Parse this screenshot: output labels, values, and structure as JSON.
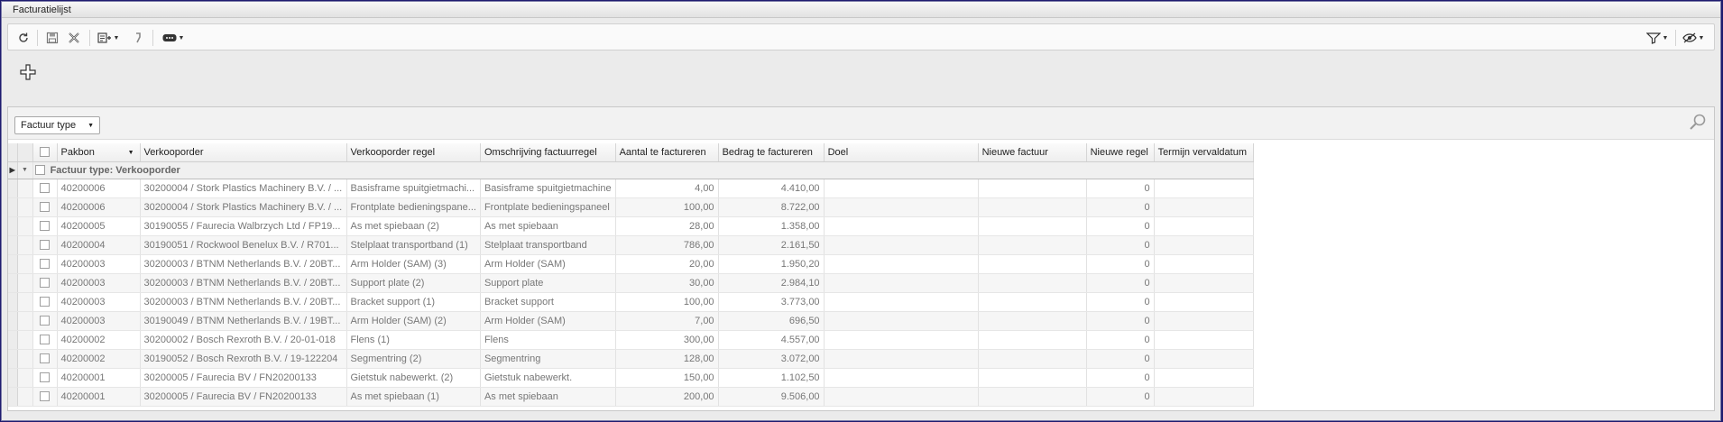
{
  "window": {
    "title": "Facturatielijst"
  },
  "toolbar": {
    "icons": [
      "refresh-icon",
      "save-icon",
      "cancel-icon",
      "export-menu-icon",
      "step-icon",
      "more-menu-icon",
      "filter-icon",
      "view-options-icon"
    ]
  },
  "group": {
    "chip_label": "Factuur type"
  },
  "grid": {
    "columns": [
      "Pakbon",
      "Verkooporder",
      "Verkooporder regel",
      "Omschrijving factuurregel",
      "Aantal te factureren",
      "Bedrag te factureren",
      "Doel",
      "Nieuwe factuur",
      "Nieuwe regel",
      "Termijn vervaldatum"
    ],
    "group_row": "Factuur type: Verkooporder",
    "rows": [
      {
        "pakbon": "40200006",
        "order": "30200004 / Stork Plastics Machinery B.V. / ...",
        "regel": "Basisframe spuitgietmachi...",
        "omschrijving": "Basisframe spuitgietmachine",
        "aantal": "4,00",
        "bedrag": "4.410,00",
        "doel": "",
        "nieuwe_factuur": "",
        "nieuwe_regel": "0",
        "termijn": ""
      },
      {
        "pakbon": "40200006",
        "order": "30200004 / Stork Plastics Machinery B.V. / ...",
        "regel": "Frontplate bedieningspane...",
        "omschrijving": "Frontplate bedieningspaneel",
        "aantal": "100,00",
        "bedrag": "8.722,00",
        "doel": "",
        "nieuwe_factuur": "",
        "nieuwe_regel": "0",
        "termijn": ""
      },
      {
        "pakbon": "40200005",
        "order": "30190055 / Faurecia Walbrzych Ltd / FP19...",
        "regel": "As met spiebaan (2)",
        "omschrijving": "As met spiebaan",
        "aantal": "28,00",
        "bedrag": "1.358,00",
        "doel": "",
        "nieuwe_factuur": "",
        "nieuwe_regel": "0",
        "termijn": ""
      },
      {
        "pakbon": "40200004",
        "order": "30190051 / Rockwool Benelux B.V. / R701...",
        "regel": "Stelplaat transportband (1)",
        "omschrijving": "Stelplaat transportband",
        "aantal": "786,00",
        "bedrag": "2.161,50",
        "doel": "",
        "nieuwe_factuur": "",
        "nieuwe_regel": "0",
        "termijn": ""
      },
      {
        "pakbon": "40200003",
        "order": "30200003 / BTNM Netherlands B.V. / 20BT...",
        "regel": "Arm Holder (SAM) (3)",
        "omschrijving": "Arm Holder (SAM)",
        "aantal": "20,00",
        "bedrag": "1.950,20",
        "doel": "",
        "nieuwe_factuur": "",
        "nieuwe_regel": "0",
        "termijn": ""
      },
      {
        "pakbon": "40200003",
        "order": "30200003 / BTNM Netherlands B.V. / 20BT...",
        "regel": "Support plate (2)",
        "omschrijving": "Support plate",
        "aantal": "30,00",
        "bedrag": "2.984,10",
        "doel": "",
        "nieuwe_factuur": "",
        "nieuwe_regel": "0",
        "termijn": ""
      },
      {
        "pakbon": "40200003",
        "order": "30200003 / BTNM Netherlands B.V. / 20BT...",
        "regel": "Bracket support (1)",
        "omschrijving": "Bracket support",
        "aantal": "100,00",
        "bedrag": "3.773,00",
        "doel": "",
        "nieuwe_factuur": "",
        "nieuwe_regel": "0",
        "termijn": ""
      },
      {
        "pakbon": "40200003",
        "order": "30190049 / BTNM Netherlands B.V. / 19BT...",
        "regel": "Arm Holder (SAM) (2)",
        "omschrijving": "Arm Holder (SAM)",
        "aantal": "7,00",
        "bedrag": "696,50",
        "doel": "",
        "nieuwe_factuur": "",
        "nieuwe_regel": "0",
        "termijn": ""
      },
      {
        "pakbon": "40200002",
        "order": "30200002 / Bosch Rexroth B.V. / 20-01-018",
        "regel": "Flens (1)",
        "omschrijving": "Flens",
        "aantal": "300,00",
        "bedrag": "4.557,00",
        "doel": "",
        "nieuwe_factuur": "",
        "nieuwe_regel": "0",
        "termijn": ""
      },
      {
        "pakbon": "40200002",
        "order": "30190052 / Bosch Rexroth B.V. / 19-122204",
        "regel": "Segmentring (2)",
        "omschrijving": "Segmentring",
        "aantal": "128,00",
        "bedrag": "3.072,00",
        "doel": "",
        "nieuwe_factuur": "",
        "nieuwe_regel": "0",
        "termijn": ""
      },
      {
        "pakbon": "40200001",
        "order": "30200005 / Faurecia BV / FN20200133",
        "regel": "Gietstuk nabewerkt. (2)",
        "omschrijving": "Gietstuk nabewerkt.",
        "aantal": "150,00",
        "bedrag": "1.102,50",
        "doel": "",
        "nieuwe_factuur": "",
        "nieuwe_regel": "0",
        "termijn": ""
      },
      {
        "pakbon": "40200001",
        "order": "30200005 / Faurecia BV / FN20200133",
        "regel": "As met spiebaan (1)",
        "omschrijving": "As met spiebaan",
        "aantal": "200,00",
        "bedrag": "9.506,00",
        "doel": "",
        "nieuwe_factuur": "",
        "nieuwe_regel": "0",
        "termijn": ""
      }
    ]
  }
}
